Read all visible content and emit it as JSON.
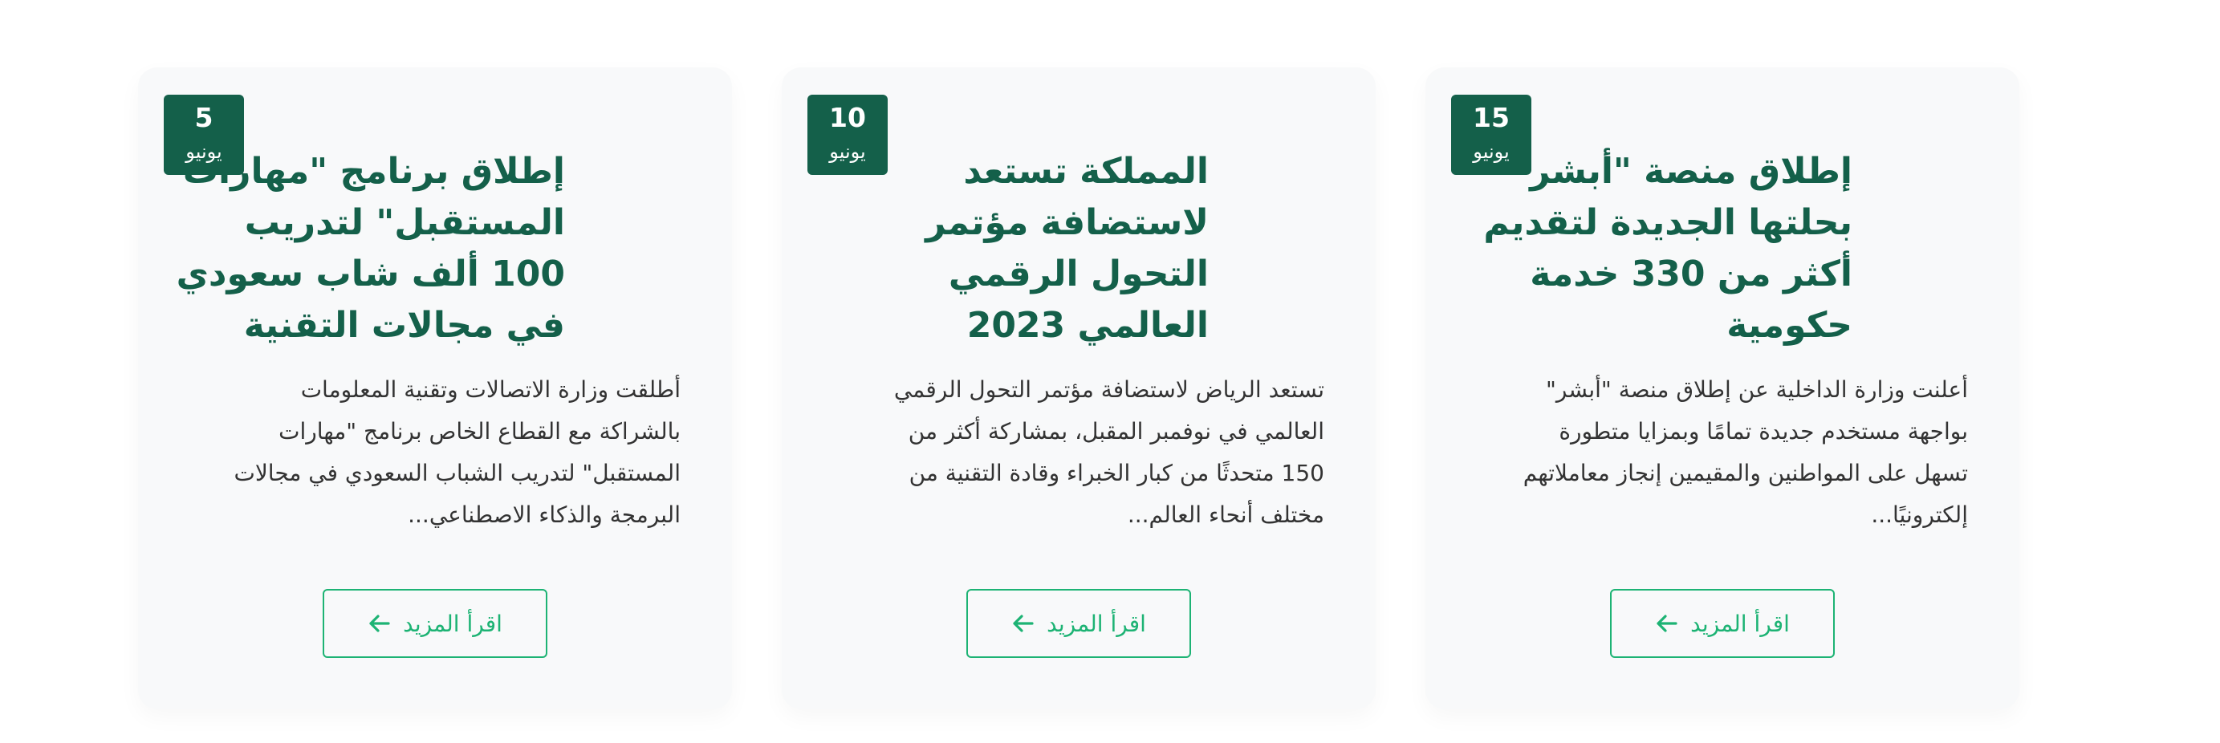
{
  "cards": [
    {
      "date": {
        "day": "15",
        "month": "يونيو"
      },
      "title": "إطلاق منصة \"أبشر\" بحلتها الجديدة لتقديم أكثر من 330 خدمة حكومية",
      "excerpt": "أعلنت وزارة الداخلية عن إطلاق منصة \"أبشر\" بواجهة مستخدم جديدة تمامًا وبمزايا متطورة تسهل على المواطنين والمقيمين إنجاز معاملاتهم إلكترونيًا...",
      "read_more": "اقرأ المزيد"
    },
    {
      "date": {
        "day": "10",
        "month": "يونيو"
      },
      "title": "المملكة تستعد لاستضافة مؤتمر التحول الرقمي العالمي 2023",
      "excerpt": "تستعد الرياض لاستضافة مؤتمر التحول الرقمي العالمي في نوفمبر المقبل، بمشاركة أكثر من 150 متحدثًا من كبار الخبراء وقادة التقنية من مختلف أنحاء العالم...",
      "read_more": "اقرأ المزيد"
    },
    {
      "date": {
        "day": "5",
        "month": "يونيو"
      },
      "title": "إطلاق برنامج \"مهارات المستقبل\" لتدريب 100 ألف شاب سعودي في مجالات التقنية",
      "excerpt": "أطلقت وزارة الاتصالات وتقنية المعلومات بالشراكة مع القطاع الخاص برنامج \"مهارات المستقبل\" لتدريب الشباب السعودي في مجالات البرمجة والذكاء الاصطناعي...",
      "read_more": "اقرأ المزيد"
    }
  ],
  "colors": {
    "primary": "#14604a",
    "accent": "#1db374",
    "card_bg": "#f8f9fa",
    "text": "#333333"
  },
  "icons": {
    "read_more": "arrow-left-icon"
  }
}
